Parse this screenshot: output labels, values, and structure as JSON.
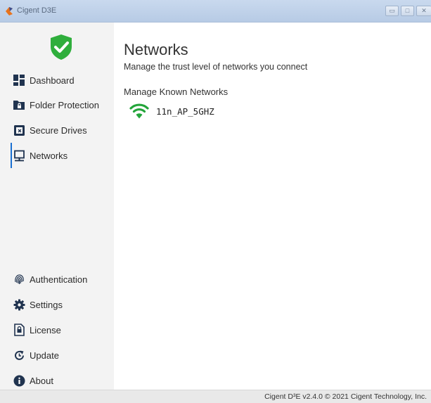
{
  "window": {
    "title": "Cigent D3E",
    "minimize_symbol": "▭",
    "maximize_symbol": "□",
    "close_symbol": "✕"
  },
  "sidebar": {
    "status_icon": "shield-check-icon",
    "top_items": [
      {
        "label": "Dashboard",
        "icon": "dashboard-icon"
      },
      {
        "label": "Folder Protection",
        "icon": "folder-lock-icon"
      },
      {
        "label": "Secure Drives",
        "icon": "secure-drive-icon"
      },
      {
        "label": "Networks",
        "icon": "network-icon",
        "active": true
      }
    ],
    "bottom_items": [
      {
        "label": "Authentication",
        "icon": "fingerprint-icon"
      },
      {
        "label": "Settings",
        "icon": "gear-icon"
      },
      {
        "label": "License",
        "icon": "license-icon"
      },
      {
        "label": "Update",
        "icon": "update-icon"
      },
      {
        "label": "About",
        "icon": "info-icon"
      }
    ]
  },
  "main": {
    "title": "Networks",
    "subtitle": "Manage the trust level of networks you connect",
    "section_title": "Manage Known Networks",
    "networks": [
      {
        "name": "11n_AP_5GHZ",
        "icon": "wifi-icon"
      }
    ]
  },
  "footer": {
    "text": "Cigent D³E v2.4.0 © 2021 Cigent Technology, Inc."
  },
  "colors": {
    "accent": "#1a6fd1",
    "shield_green": "#2fae3c",
    "wifi_green": "#23a53a",
    "sidebar_bg": "#f3f3f3",
    "icon_dark": "#20334f"
  }
}
